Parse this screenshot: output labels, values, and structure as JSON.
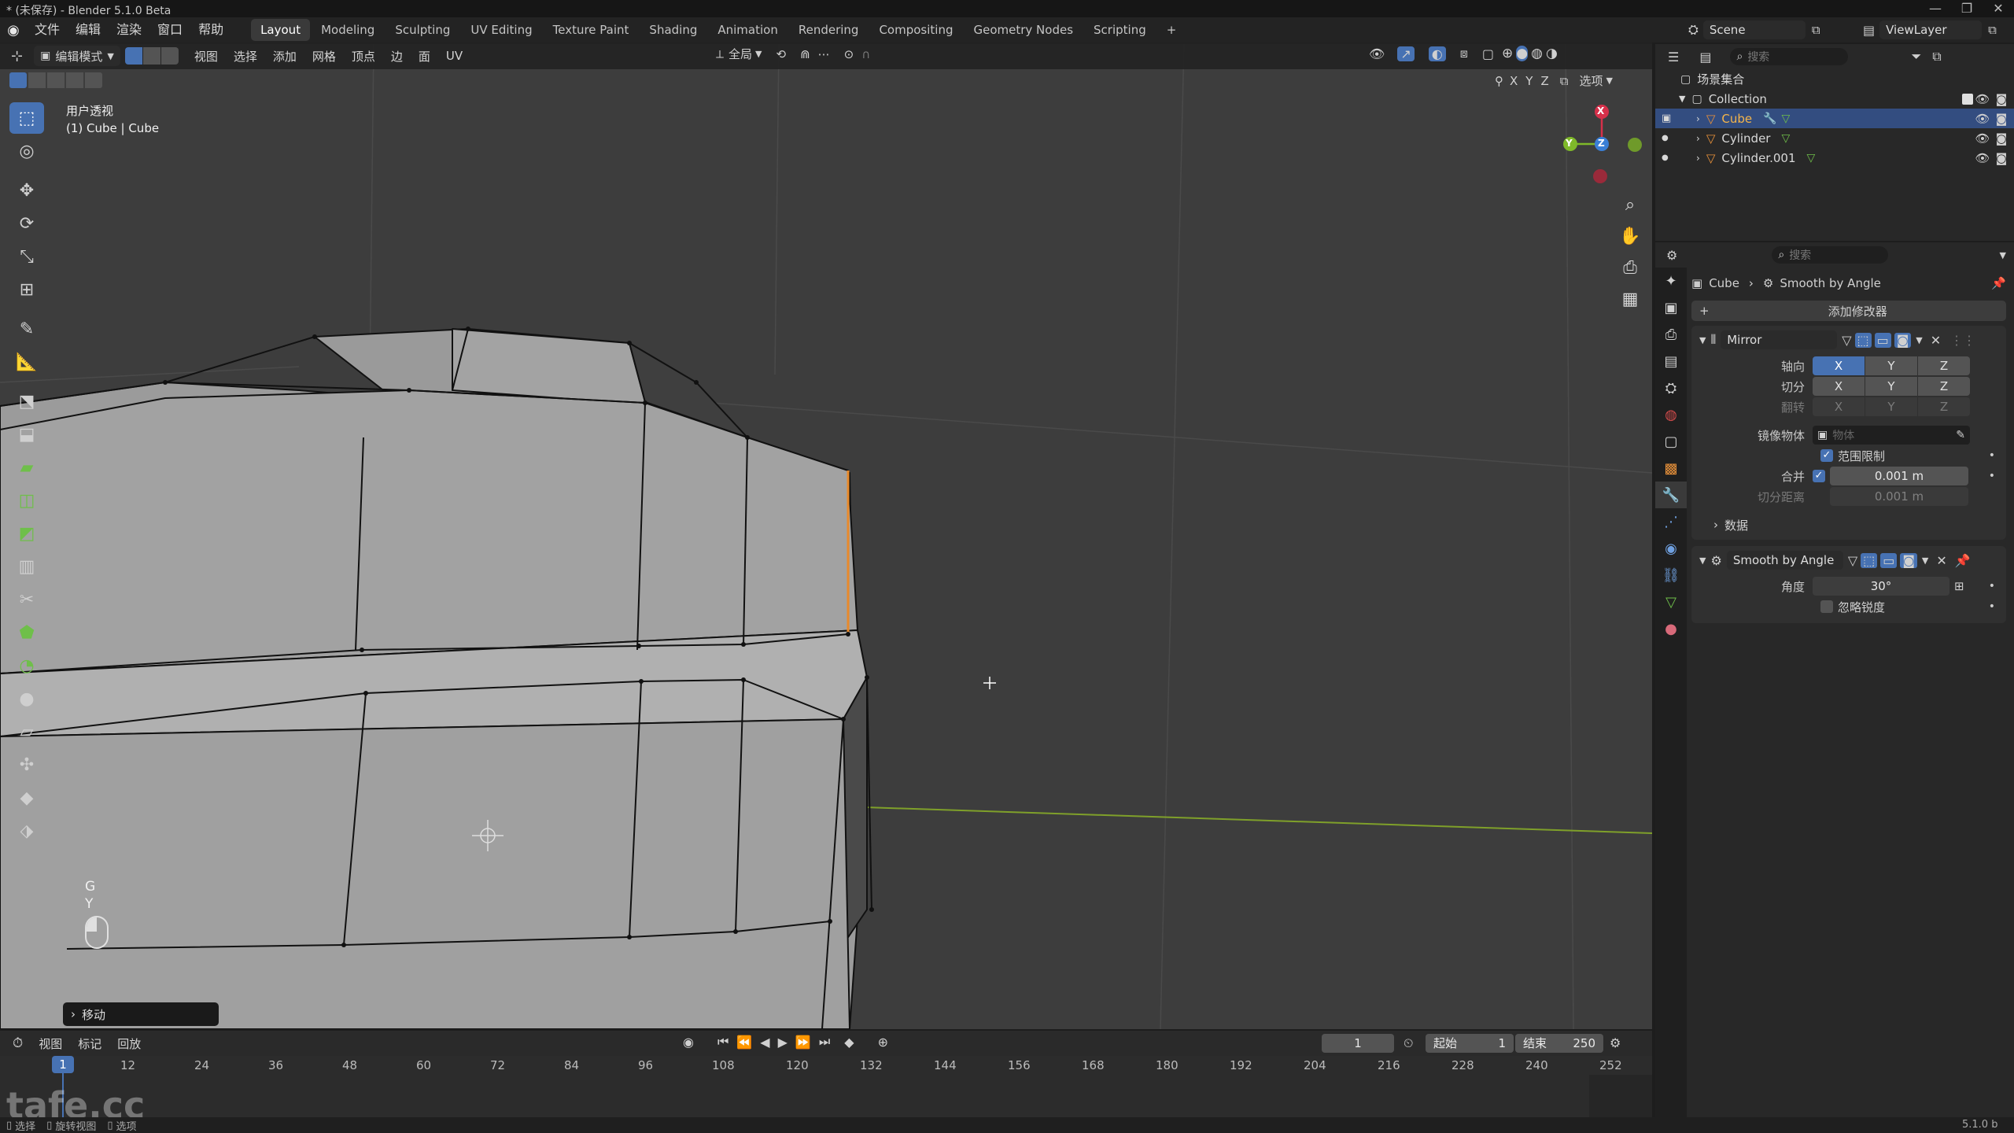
{
  "window": {
    "title": "* (未保存) - Blender 5.1.0 Beta"
  },
  "menubar": {
    "menus": [
      "文件",
      "编辑",
      "渲染",
      "窗口",
      "帮助"
    ],
    "workspaces": [
      "Layout",
      "Modeling",
      "Sculpting",
      "UV Editing",
      "Texture Paint",
      "Shading",
      "Animation",
      "Rendering",
      "Compositing",
      "Geometry Nodes",
      "Scripting"
    ],
    "active_workspace": "Layout",
    "add_tab": "+",
    "scene": "Scene",
    "view_layer": "ViewLayer"
  },
  "viewport_header": {
    "mode": "编辑模式",
    "menus": [
      "视图",
      "选择",
      "添加",
      "网格",
      "顶点",
      "边",
      "面",
      "UV"
    ],
    "transform_orientation": "全局",
    "options": "选项",
    "axes": [
      "X",
      "Y",
      "Z"
    ]
  },
  "viewport": {
    "view_name": "用户透视",
    "object_info": "(1) Cube | Cube",
    "gizmo_axes": {
      "x": "X",
      "y": "Y",
      "z": "Z"
    },
    "key_hint_1": "G",
    "key_hint_2": "Y",
    "last_operator": "移动"
  },
  "timeline": {
    "menus": [
      "视图",
      "标记",
      "回放"
    ],
    "current_frame": "1",
    "start_label": "起始",
    "start_value": "1",
    "end_label": "结束",
    "end_value": "250",
    "ticks": [
      "12",
      "24",
      "36",
      "48",
      "60",
      "72",
      "84",
      "96",
      "108",
      "120",
      "132",
      "144",
      "156",
      "168",
      "180",
      "192",
      "204",
      "216",
      "228",
      "240",
      "252"
    ],
    "playhead": "1"
  },
  "statusbar": {
    "items": [
      "选择",
      "旋转视图",
      "选项"
    ],
    "version": "5.1.0 b",
    "watermark": "tafe.cc"
  },
  "outliner": {
    "search_placeholder": "搜索",
    "scene_collection": "场景集合",
    "collection": "Collection",
    "objects": [
      {
        "name": "Cube",
        "selected": true
      },
      {
        "name": "Cylinder",
        "selected": false
      },
      {
        "name": "Cylinder.001",
        "selected": false
      }
    ]
  },
  "properties": {
    "search_placeholder": "搜索",
    "breadcrumb_object": "Cube",
    "breadcrumb_modifier": "Smooth by Angle",
    "add_modifier": "添加修改器",
    "mirror": {
      "name": "Mirror",
      "axis_label": "轴向",
      "bisect_label": "切分",
      "flip_label": "翻转",
      "axes": [
        "X",
        "Y",
        "Z"
      ],
      "mirror_object_label": "镜像物体",
      "mirror_object_placeholder": "物体",
      "clipping_label": "范围限制",
      "merge_label": "合并",
      "merge_value": "0.001 m",
      "bisect_distance_label": "切分距离",
      "bisect_distance_value": "0.001 m",
      "data_section": "数据"
    },
    "smooth": {
      "name": "Smooth by Angle",
      "angle_label": "角度",
      "angle_value": "30°",
      "ignore_sharp_label": "忽略锐度"
    }
  },
  "colors": {
    "accent": "#4772b3",
    "selected_row": "#334d80",
    "viewport_bg": "#3d3d3d",
    "edge_highlight": "#e88a2c",
    "axis_x": "#d6304a",
    "axis_y": "#7fb92a",
    "axis_z": "#3a7fd6"
  }
}
